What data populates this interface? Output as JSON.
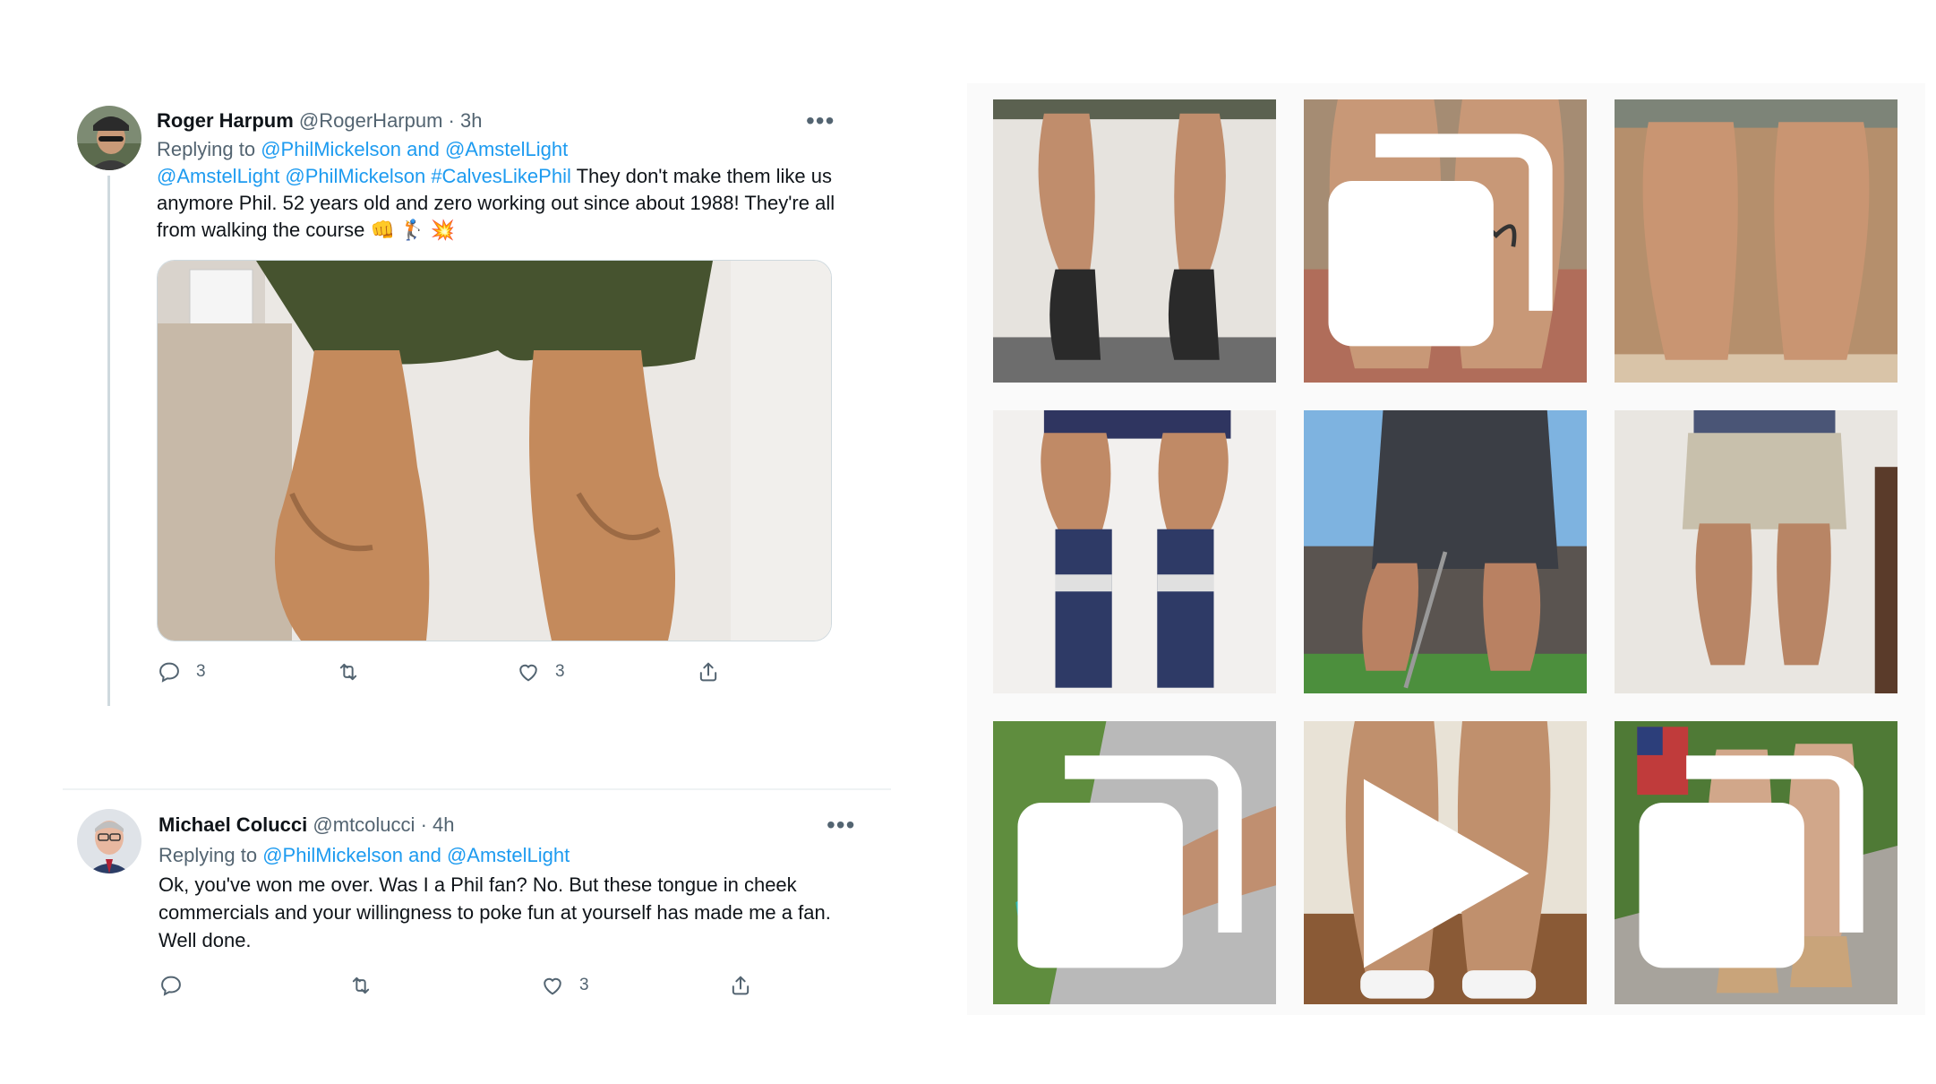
{
  "tweets": [
    {
      "display_name": "Roger Harpum",
      "handle": "@RogerHarpum",
      "time": "· 3h",
      "replying_prefix": "Replying to",
      "replying_targets": "@PhilMickelson and @AmstelLight",
      "body_links": "@AmstelLight @PhilMickelson #CalvesLikePhil",
      "body_text": " They don't make them like us anymore Phil. 52 years old and zero working out since about 1988! They're all from walking the course",
      "body_emoji": "👊 🏌 💥",
      "actions": {
        "reply_count": "3",
        "retweet_count": "",
        "like_count": "3"
      }
    },
    {
      "display_name": "Michael Colucci",
      "handle": "@mtcolucci",
      "time": "· 4h",
      "replying_prefix": "Replying to",
      "replying_targets": "@PhilMickelson and @AmstelLight",
      "body_text": "Ok, you've won me over. Was I a Phil fan?  No. But these tongue in cheek commercials and your willingness to poke fun at yourself has made me a fan. Well done.",
      "actions": {
        "reply_count": "",
        "retweet_count": "",
        "like_count": "3"
      }
    }
  ],
  "more_label": "•••",
  "icons": {
    "reply": "reply-icon",
    "retweet": "retweet-icon",
    "like": "heart-icon",
    "share": "share-icon",
    "more": "more-icon",
    "carousel_badge": "carousel-icon",
    "video_badge": "play-icon"
  },
  "colors": {
    "link": "#1d9bf0",
    "muted": "#536471",
    "text": "#0f1419",
    "grid_background": "#fafafa"
  },
  "photo_grid": {
    "tiles": [
      {
        "subject": "calves-in-black-socks",
        "badge": ""
      },
      {
        "subject": "calves-with-tattoo",
        "badge": "carousel"
      },
      {
        "subject": "calves-in-grey-shorts",
        "badge": ""
      },
      {
        "subject": "calves-in-patterned-socks",
        "badge": ""
      },
      {
        "subject": "calves-with-golf-club",
        "badge": ""
      },
      {
        "subject": "calves-in-khaki-shorts",
        "badge": ""
      },
      {
        "subject": "calf-with-teal-sneaker",
        "badge": "carousel"
      },
      {
        "subject": "calves-on-wood-floor",
        "badge": "video"
      },
      {
        "subject": "calves-in-wedge-sandals",
        "badge": "carousel"
      }
    ]
  }
}
